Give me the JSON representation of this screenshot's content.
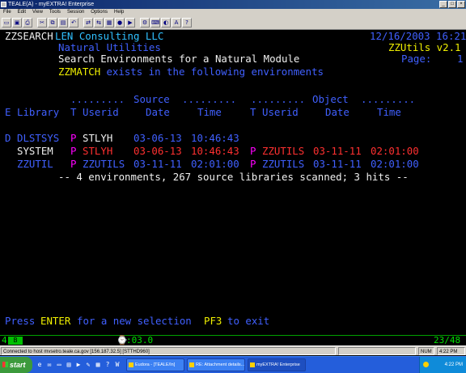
{
  "window": {
    "title": "TEALE(A) - myEXTRA! Enterprise",
    "controls": [
      "_",
      "□",
      "×"
    ]
  },
  "menu": [
    "File",
    "Edit",
    "View",
    "Tools",
    "Session",
    "Options",
    "Help"
  ],
  "toolbar": {
    "icons": [
      "open-icon",
      "save-icon",
      "print-icon",
      "cut-icon",
      "copy-icon",
      "paste-icon",
      "undo-icon",
      "connect-icon",
      "disconnect-icon",
      "macro-icon",
      "record-icon",
      "play-icon",
      "settings-icon",
      "keyboard-icon",
      "color-icon",
      "font-icon",
      "help-icon"
    ],
    "glyphs": [
      "▭",
      "▣",
      "⎙",
      "✂",
      "⧉",
      "▤",
      "↶",
      "⇄",
      "⇆",
      "▦",
      "●",
      "▶",
      "⚙",
      "⌨",
      "◐",
      "A",
      "?"
    ]
  },
  "terminal": {
    "program": "ZZSEARCH",
    "company": "LEN Consulting LLC",
    "date_time": "12/16/2003 16:21",
    "subtitle": "Natural Utilities",
    "product": "ZZUtils v2.1",
    "heading": "Search Environments for a Natural Module",
    "page_label": "Page:",
    "page_number": "1",
    "module": "ZZMATCH",
    "module_message": " exists in the following environments",
    "header_row1": {
      "src_dots1": ".........",
      "source": "Source",
      "src_dots2": ".........",
      "obj_dots1": ".........",
      "object": "Object",
      "obj_dots2": "........."
    },
    "header_row2": {
      "e": "E",
      "library": "Library",
      "t1": "T",
      "userid1": "Userid",
      "date1": "Date",
      "time1": "Time",
      "t2": "T",
      "userid2": "Userid",
      "date2": "Date",
      "time2": "Time"
    },
    "rows": [
      {
        "e": "D",
        "library": "DLSTSYS",
        "t1": "P",
        "userid1": "STLYH",
        "date1": "03-06-13",
        "time1": "10:46:43",
        "t2": "",
        "userid2": "",
        "date2": "",
        "time2": ""
      },
      {
        "e": "",
        "library": "SYSTEM",
        "t1": "P",
        "userid1": "STLYH",
        "date1": "03-06-13",
        "time1": "10:46:43",
        "t2": "P",
        "userid2": "ZZUTILS",
        "date2": "03-11-11",
        "time2": "02:01:00"
      },
      {
        "e": "",
        "library": "ZZUTIL",
        "t1": "P",
        "userid1": "ZZUTILS",
        "date1": "03-11-11",
        "time1": "02:01:00",
        "t2": "P",
        "userid2": "ZZUTILS",
        "date2": "03-11-11",
        "time2": "02:01:00"
      }
    ],
    "summary": "-- 4 environments, 267 source libraries scanned; 3 hits --",
    "footer": {
      "press": "Press",
      "enter": "ENTER",
      "for_new": "for a new selection",
      "pf3": "PF3",
      "to_exit": "to exit"
    }
  },
  "oia": {
    "indicator": "4",
    "box": "B",
    "system_status": ":03.0",
    "cursor_pos": "23/48"
  },
  "statusline": {
    "connection": "Connected to host mvsetro.teale.ca.gov [156.187.32.5]  [STTHD960]",
    "mode": "NUM",
    "time": "4:22 PM"
  },
  "taskbar": {
    "start": "start",
    "tasks": [
      "Eudora - [TEALE/In]",
      "RE: Attachment details...",
      "myEXTRA! Enterprise"
    ],
    "clock": "4:22 PM"
  },
  "colors": {
    "green": "#00e000",
    "blue": "#4060ff",
    "white": "#f0f0f0",
    "yellow": "#f0f000",
    "red": "#ff3030",
    "cyan": "#30c0ff"
  }
}
